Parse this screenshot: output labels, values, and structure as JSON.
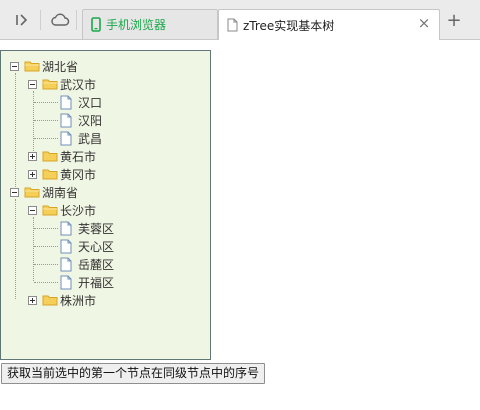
{
  "browser": {
    "tabs": [
      {
        "label": "手机浏览器",
        "icon": "mobile-phone-icon",
        "active": false,
        "color": "#1aa84a"
      },
      {
        "label": "zTree实现基本树",
        "icon": "document-icon",
        "active": true
      }
    ]
  },
  "tree": {
    "nodes": [
      {
        "label": "湖北省",
        "type": "folder",
        "state": "open"
      },
      {
        "label": "武汉市",
        "type": "folder",
        "state": "open"
      },
      {
        "label": "汉口",
        "type": "file"
      },
      {
        "label": "汉阳",
        "type": "file"
      },
      {
        "label": "武昌",
        "type": "file"
      },
      {
        "label": "黄石市",
        "type": "folder",
        "state": "closed"
      },
      {
        "label": "黄冈市",
        "type": "folder",
        "state": "closed"
      },
      {
        "label": "湖南省",
        "type": "folder",
        "state": "open"
      },
      {
        "label": "长沙市",
        "type": "folder",
        "state": "open"
      },
      {
        "label": "芙蓉区",
        "type": "file"
      },
      {
        "label": "天心区",
        "type": "file"
      },
      {
        "label": "岳麓区",
        "type": "file"
      },
      {
        "label": "开福区",
        "type": "file"
      },
      {
        "label": "株洲市",
        "type": "folder",
        "state": "closed"
      }
    ],
    "panel_color": "#f0f6e4",
    "folder_color": "#f5cf58"
  },
  "action_button": {
    "label": "获取当前选中的第一个节点在同级节点中的序号"
  }
}
